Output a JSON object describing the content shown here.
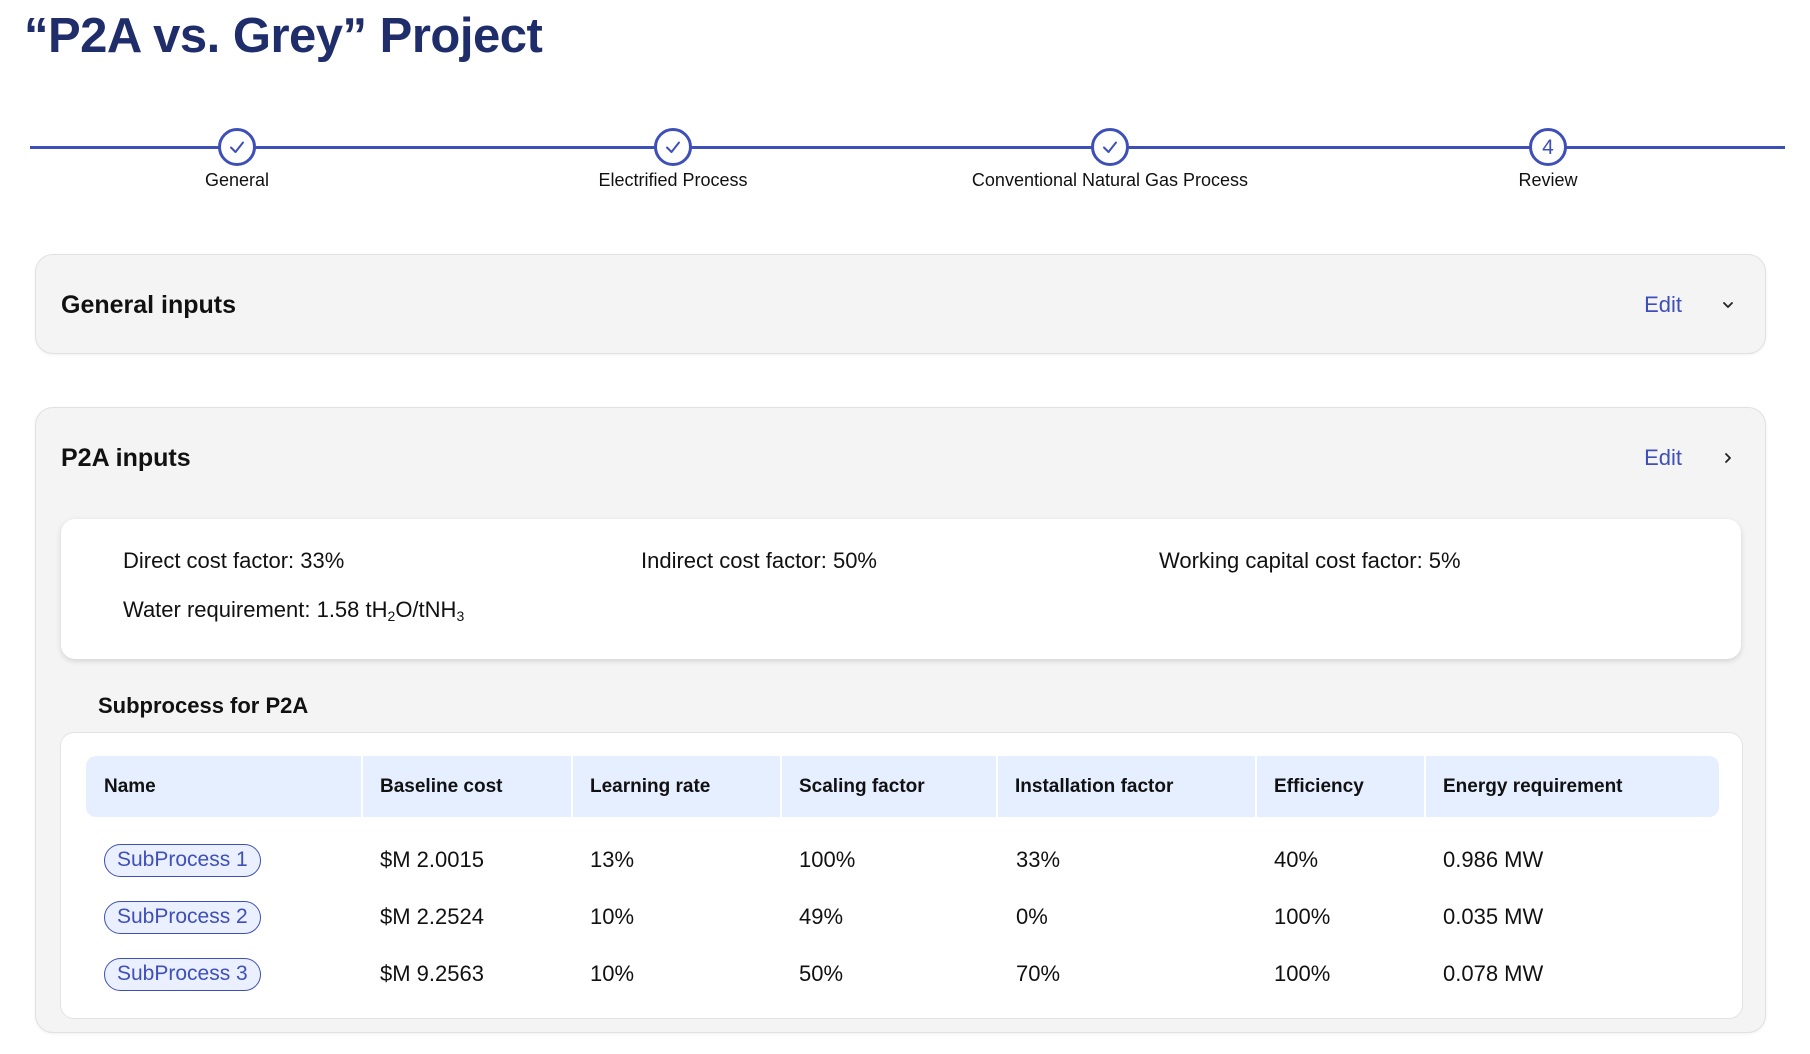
{
  "page": {
    "title": "“P2A vs. Grey” Project"
  },
  "stepper": {
    "steps": [
      {
        "label": "General",
        "state": "complete",
        "icon": "check-icon"
      },
      {
        "label": "Electrified Process",
        "state": "complete",
        "icon": "check-icon"
      },
      {
        "label": "Conventional Natural Gas Process",
        "state": "complete",
        "icon": "check-icon"
      },
      {
        "label": "Review",
        "state": "current",
        "number": "4"
      }
    ],
    "accent": "#3f4fb8"
  },
  "general_card": {
    "title": "General inputs",
    "edit_label": "Edit",
    "toggle_icon": "chevron-down-icon"
  },
  "p2a_card": {
    "title": "P2A inputs",
    "edit_label": "Edit",
    "toggle_icon": "chevron-right-icon",
    "factors": {
      "direct_cost": "Direct cost factor: 33%",
      "indirect_cost": "Indirect cost factor: 50%",
      "working_capital": "Working capital cost factor: 5%",
      "water_prefix": "Water requirement: 1.58 tH",
      "water_sub1": "2",
      "water_mid": "O/tNH",
      "water_sub2": "3"
    },
    "subprocess_heading": "Subprocess for P2A",
    "table": {
      "columns": [
        "Name",
        "Baseline cost",
        "Learning rate",
        "Scaling factor",
        "Installation factor",
        "Efficiency",
        "Energy requirement"
      ],
      "rows": [
        [
          "SubProcess 1",
          "$M 2.0015",
          "13%",
          "100%",
          "33%",
          "40%",
          "0.986 MW"
        ],
        [
          "SubProcess 2",
          "$M 2.2524",
          "10%",
          "49%",
          "0%",
          "100%",
          "0.035 MW"
        ],
        [
          "SubProcess 3",
          "$M 9.2563",
          "10%",
          "50%",
          "70%",
          "100%",
          "0.078 MW"
        ]
      ]
    }
  },
  "colors": {
    "title": "#1f2d6b",
    "accent": "#3f4fb8",
    "table_header_bg": "#e6efff",
    "card_bg": "#f4f4f4"
  }
}
